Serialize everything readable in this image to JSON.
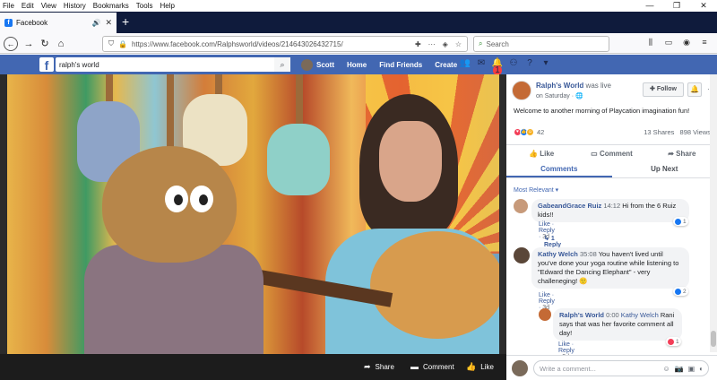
{
  "menu": {
    "items": [
      "File",
      "Edit",
      "View",
      "History",
      "Bookmarks",
      "Tools",
      "Help"
    ]
  },
  "window_controls": {
    "minimize": "—",
    "restore": "❐",
    "close": "✕"
  },
  "tab": {
    "title": "Facebook",
    "favicon": "f"
  },
  "nav": {
    "url": "https://www.facebook.com/Ralphsworld/videos/214643026432715/",
    "search_placeholder": "Search"
  },
  "fb": {
    "logo": "f",
    "search_value": "ralph's world",
    "user": "Scott",
    "links": [
      "Home",
      "Find Friends",
      "Create"
    ],
    "notification_count": "1",
    "icons": [
      "friends-icon",
      "messenger-icon",
      "notifications-icon",
      "quick-help-icon",
      "help-icon",
      "menu-caret-icon"
    ]
  },
  "video": {
    "share": "Share",
    "comment": "Comment",
    "like": "Like"
  },
  "post": {
    "page_name": "Ralph's World",
    "was_live": "was live",
    "time": "on Saturday · ",
    "follow": "Follow",
    "description": "Welcome to another morning of Playcation imagination fun!",
    "reaction_count": "42",
    "shares": "13 Shares",
    "views": "898 Views",
    "actions": {
      "like": "Like",
      "comment": "Comment",
      "share": "Share"
    },
    "tabs": {
      "comments": "Comments",
      "up_next": "Up Next"
    },
    "sort": "Most Relevant ▾",
    "reaction_colors": {
      "like": "#1877f2",
      "love": "#f33e58",
      "haha": "#f7b125"
    }
  },
  "comments": [
    {
      "author": "GabeandGrace Ruiz",
      "time": "14:12",
      "text": "Hi from the 6 Ruiz kids!!",
      "like": "Like",
      "reply": "Reply",
      "age": "3d",
      "likes": "1",
      "replies": "1 Reply"
    },
    {
      "author": "Kathy Welch",
      "time": "35:08",
      "text": "You haven't lived until you've done your yoga routine while listening to \"Edward the Dancing Elephant\" - very challeneging! 🙂",
      "like": "Like",
      "reply": "Reply",
      "age": "3d",
      "likes": "2"
    },
    {
      "author": "Ralph's World",
      "time": "0:00",
      "mention": "Kathy Welch",
      "text": "Rani says that was her favorite comment all day!",
      "like": "Like",
      "reply": "Reply",
      "age": "3d",
      "likes": "1"
    }
  ],
  "write": {
    "placeholder": "Write a comment..."
  }
}
